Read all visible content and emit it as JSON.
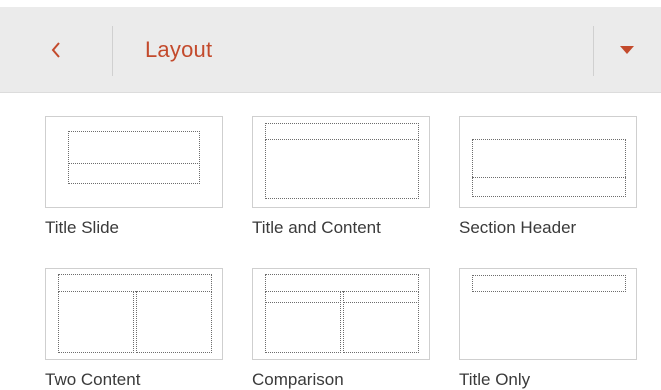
{
  "header": {
    "title": "Layout",
    "back_icon": "chevron-left-icon",
    "menu_icon": "caret-down-icon",
    "accent_color": "#c34a2c"
  },
  "layouts": [
    {
      "label": "Title Slide"
    },
    {
      "label": "Title and Content"
    },
    {
      "label": "Section Header"
    },
    {
      "label": "Two Content"
    },
    {
      "label": "Comparison"
    },
    {
      "label": "Title Only"
    }
  ]
}
